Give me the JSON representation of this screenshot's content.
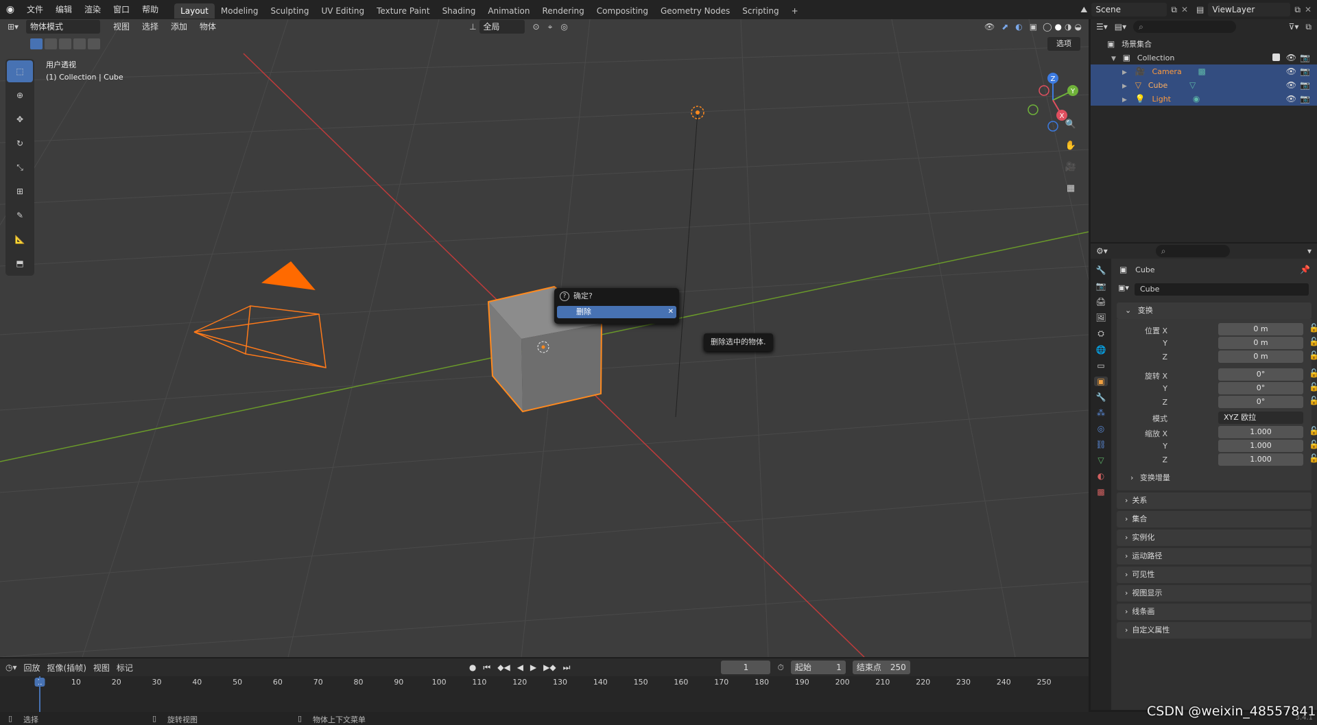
{
  "topbar": {
    "menus": [
      "文件",
      "编辑",
      "渲染",
      "窗口",
      "帮助"
    ],
    "workspaces": [
      "Layout",
      "Modeling",
      "Sculpting",
      "UV Editing",
      "Texture Paint",
      "Shading",
      "Animation",
      "Rendering",
      "Compositing",
      "Geometry Nodes",
      "Scripting"
    ],
    "active_workspace": "Layout",
    "add_tab": "+",
    "scene": "Scene",
    "view_layer": "ViewLayer"
  },
  "viewport": {
    "mode": "物体模式",
    "menus": [
      "视图",
      "选择",
      "添加",
      "物体"
    ],
    "transform_orientation": "全局",
    "options_label": "选项",
    "view_name": "用户透视",
    "context_line": "(1) Collection | Cube",
    "gizmo": {
      "x": "X",
      "y": "Y",
      "z": "Z"
    }
  },
  "popup": {
    "title": "确定?",
    "action": "删除",
    "tooltip": "删除选中的物体."
  },
  "outliner": {
    "root": "场景集合",
    "collection": "Collection",
    "objects": [
      "Camera",
      "Cube",
      "Light"
    ]
  },
  "properties": {
    "object_name_header": "Cube",
    "object_name_field": "Cube",
    "transform_section": "变换",
    "location_label": "位置 X",
    "rotation_label": "旋转 X",
    "scale_label": "缩放 X",
    "axis_y": "Y",
    "axis_z": "Z",
    "location": [
      "0 m",
      "0 m",
      "0 m"
    ],
    "rotation": [
      "0°",
      "0°",
      "0°"
    ],
    "mode_label": "模式",
    "rotation_mode": "XYZ 欧拉",
    "scale": [
      "1.000",
      "1.000",
      "1.000"
    ],
    "delta_transform": "变换增量",
    "sections": [
      "关系",
      "集合",
      "实例化",
      "运动路径",
      "可见性",
      "视图显示",
      "线条画",
      "自定义属性"
    ]
  },
  "timeline": {
    "playback": "回放",
    "keying": "抠像(插帧)",
    "view": "视图",
    "marker": "标记",
    "current_frame": "1",
    "start_label": "起始",
    "start": "1",
    "end_label": "结束点",
    "end": "250",
    "ticks": [
      "1",
      "10",
      "20",
      "30",
      "40",
      "50",
      "60",
      "70",
      "80",
      "90",
      "100",
      "110",
      "120",
      "130",
      "140",
      "150",
      "160",
      "170",
      "180",
      "190",
      "200",
      "210",
      "220",
      "230",
      "240",
      "250"
    ]
  },
  "statusbar": {
    "select": "选择",
    "rotate_view": "旋转视图",
    "context_menu": "物体上下文菜单",
    "version": "3.4.1"
  },
  "watermark": "CSDN @weixin_48557841",
  "colors": {
    "accent": "#4772b3",
    "selected_orange": "#ff8a1f",
    "axis_red": "#c03b3b",
    "axis_green": "#6a9a2a"
  }
}
